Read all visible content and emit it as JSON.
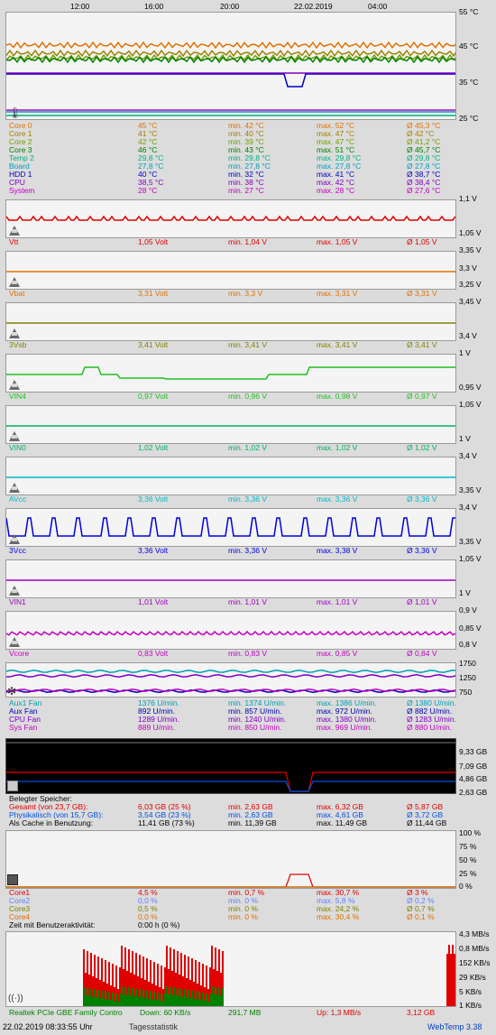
{
  "time_axis": [
    "12:00",
    "16:00",
    "20:00",
    "22.02.2019",
    "04:00"
  ],
  "colors": {
    "red": "#e00000",
    "orange": "#e07000",
    "olive": "#808000",
    "green": "#008000",
    "lime": "#00c000",
    "teal": "#00a090",
    "cyan": "#00b0c0",
    "navy": "#000090",
    "blue": "#0000ff",
    "violet": "#9000c0",
    "purple": "#a000a0",
    "magenta": "#c000c0",
    "brown": "#b06000",
    "ltblue": "#4080ff"
  },
  "temperature": {
    "y_labels": [
      "55 °C",
      "45 °C",
      "35 °C",
      "25 °C"
    ],
    "rows": [
      {
        "name": "Core 0",
        "cur": "45 °C",
        "min": "min. 42 °C",
        "max": "max. 52 °C",
        "avg": "Ø 45,3 °C",
        "color": "#e07000"
      },
      {
        "name": "Core 1",
        "cur": "41 °C",
        "min": "min. 40 °C",
        "max": "max. 47 °C",
        "avg": "Ø 42 °C",
        "color": "#a08000"
      },
      {
        "name": "Core 2",
        "cur": "42 °C",
        "min": "min. 39 °C",
        "max": "max. 47 °C",
        "avg": "Ø 41,2 °C",
        "color": "#70a000"
      },
      {
        "name": "Core 3",
        "cur": "46 °C",
        "min": "min. 43 °C",
        "max": "max. 51 °C",
        "avg": "Ø 45,7 °C",
        "color": "#008000"
      },
      {
        "name": "Temp 2",
        "cur": "29,8 °C",
        "min": "min. 29,8 °C",
        "max": "max. 29,8 °C",
        "avg": "Ø 29,8 °C",
        "color": "#00b080"
      },
      {
        "name": "Board",
        "cur": "27,8 °C",
        "min": "min. 27,8 °C",
        "max": "max. 27,8 °C",
        "avg": "Ø 27,8 °C",
        "color": "#00a0c0"
      },
      {
        "name": "HDD 1",
        "cur": "40 °C",
        "min": "min. 32 °C",
        "max": "max. 41 °C",
        "avg": "Ø 38,7 °C",
        "color": "#0000c0"
      },
      {
        "name": "CPU",
        "cur": "38,5 °C",
        "min": "min. 38 °C",
        "max": "max. 42 °C",
        "avg": "Ø 38,4 °C",
        "color": "#8000c0"
      },
      {
        "name": "System",
        "cur": "28 °C",
        "min": "min. 27 °C",
        "max": "max. 28 °C",
        "avg": "Ø 27,6 °C",
        "color": "#c000c0"
      }
    ]
  },
  "voltages": [
    {
      "name": "Vtt",
      "cur": "1,05 Volt",
      "min": "min. 1,04 V",
      "max": "max. 1,05 V",
      "avg": "Ø 1,05 V",
      "color": "#e00000",
      "y_top": "1,1 V",
      "y_bot": "1,05 V"
    },
    {
      "name": "Vbat",
      "cur": "3,31 Volt",
      "min": "min. 3,3 V",
      "max": "max. 3,31 V",
      "avg": "Ø 3,31 V",
      "color": "#e07000",
      "y_top": "3,35 V",
      "y_mid": "3,3 V",
      "y_bot": "3,25 V"
    },
    {
      "name": "3Vsb",
      "cur": "3,41 Volt",
      "min": "min. 3,41 V",
      "max": "max. 3,41 V",
      "avg": "Ø 3,41 V",
      "color": "#808000",
      "y_top": "3,45 V",
      "y_bot": "3,4 V"
    },
    {
      "name": "VIN4",
      "cur": "0,97 Volt",
      "min": "min. 0,96 V",
      "max": "max. 0,98 V",
      "avg": "Ø 0,97 V",
      "color": "#20c020",
      "y_top": "1 V",
      "y_bot": "0,95 V"
    },
    {
      "name": "VIN0",
      "cur": "1,02 Volt",
      "min": "min. 1,02 V",
      "max": "max. 1,02 V",
      "avg": "Ø 1,02 V",
      "color": "#00b060",
      "y_top": "1,05 V",
      "y_bot": "1 V"
    },
    {
      "name": "AVcc",
      "cur": "3,36 Volt",
      "min": "min. 3,36 V",
      "max": "max. 3,36 V",
      "avg": "Ø 3,36 V",
      "color": "#00b8c8",
      "y_top": "3,4 V",
      "y_bot": "3,35 V"
    },
    {
      "name": "3Vcc",
      "cur": "3,36 Volt",
      "min": "min. 3,36 V",
      "max": "max. 3,38 V",
      "avg": "Ø 3,36 V",
      "color": "#0000e0",
      "y_top": "3,4 V",
      "y_bot": "3,35 V"
    },
    {
      "name": "VIN1",
      "cur": "1,01 Volt",
      "min": "min. 1,01 V",
      "max": "max. 1,01 V",
      "avg": "Ø 1,01 V",
      "color": "#a000c0",
      "y_top": "1,05 V",
      "y_bot": "1 V"
    },
    {
      "name": "Vcore",
      "cur": "0,83 Volt",
      "min": "min. 0,83 V",
      "max": "max. 0,85 V",
      "avg": "Ø 0,84 V",
      "color": "#c000c0",
      "y_top": "0,9 V",
      "y_mid": "0,85 V",
      "y_bot": "0,8 V"
    }
  ],
  "fans": {
    "y_labels": [
      "1750",
      "1250",
      "750"
    ],
    "rows": [
      {
        "name": "Aux1 Fan",
        "cur": "1376 U/min.",
        "min": "min. 1374 U/min.",
        "max": "max. 1386 U/min.",
        "avg": "Ø 1380 U/min.",
        "color": "#00a0b0"
      },
      {
        "name": "Aux Fan",
        "cur": "892 U/min.",
        "min": "min. 857 U/min.",
        "max": "max. 972 U/min.",
        "avg": "Ø 882 U/min.",
        "color": "#0000b0"
      },
      {
        "name": "CPU Fan",
        "cur": "1289 U/min.",
        "min": "min. 1240 U/min.",
        "max": "max. 1380 U/min.",
        "avg": "Ø 1283 U/min.",
        "color": "#8000c0"
      },
      {
        "name": "Sys Fan",
        "cur": "889 U/min.",
        "min": "min. 850 U/min.",
        "max": "max. 969 U/min.",
        "avg": "Ø 880 U/min.",
        "color": "#c000c0"
      }
    ]
  },
  "memory": {
    "y_labels": [
      "9,33 GB",
      "7,09 GB",
      "4,86 GB",
      "2,63 GB"
    ],
    "heading": "Belegter Speicher:",
    "rows": [
      {
        "name": "Gesamt (von 23,7 GB):",
        "cur": "6,03 GB (25 %)",
        "min": "min. 2,63 GB",
        "max": "max. 6,32 GB",
        "avg": "Ø 5,87 GB",
        "color": "#e00000"
      },
      {
        "name": "Physikalisch (von 15,7 GB):",
        "cur": "3,54 GB (23 %)",
        "min": "min. 2,63 GB",
        "max": "max. 4,61 GB",
        "avg": "Ø 3,72 GB",
        "color": "#0050e0"
      },
      {
        "name": "Als Cache in Benutzung:",
        "cur": "11,41 GB (73 %)",
        "min": "min. 11,39 GB",
        "max": "max. 11,49 GB",
        "avg": "Ø 11,44 GB",
        "color": "#000000"
      }
    ]
  },
  "cpu": {
    "y_labels": [
      "100 %",
      "75 %",
      "50 %",
      "25 %",
      "0 %"
    ],
    "rows": [
      {
        "name": "Core1",
        "cur": "4,5 %",
        "min": "min. 0,7 %",
        "max": "max. 30,7 %",
        "avg": "Ø 3 %",
        "color": "#e00000"
      },
      {
        "name": "Core2",
        "cur": "0,0 %",
        "min": "min. 0 %",
        "max": "max. 5,8 %",
        "avg": "Ø 0,2 %",
        "color": "#6080ff"
      },
      {
        "name": "Core3",
        "cur": "0,5 %",
        "min": "min. 0 %",
        "max": "max. 24,2 %",
        "avg": "Ø 0,7 %",
        "color": "#808000"
      },
      {
        "name": "Core4",
        "cur": "0,0 %",
        "min": "min. 0 %",
        "max": "max. 30,4 %",
        "avg": "Ø 0,1 %",
        "color": "#e07000"
      }
    ],
    "activity_label": "Zeit mit Benutzeraktivität:",
    "activity_value": "0:00 h (0 %)"
  },
  "network": {
    "y_labels": [
      "4,3 MB/s",
      "0,8 MB/s",
      "152 KB/s",
      "29 KB/s",
      "5 KB/s",
      "1 KB/s"
    ],
    "adapter": "Realtek PCIe GBE Family Contro",
    "down": "Down: 60 KB/s",
    "down_total": "291,7 MB",
    "up": "Up: 1,3 MB/s",
    "up_total": "3,12 GB"
  },
  "footer": {
    "datetime": "22.02.2019 08:33:55 Uhr",
    "stats_link": "Tagesstatistik",
    "version": "WebTemp 3.38"
  }
}
